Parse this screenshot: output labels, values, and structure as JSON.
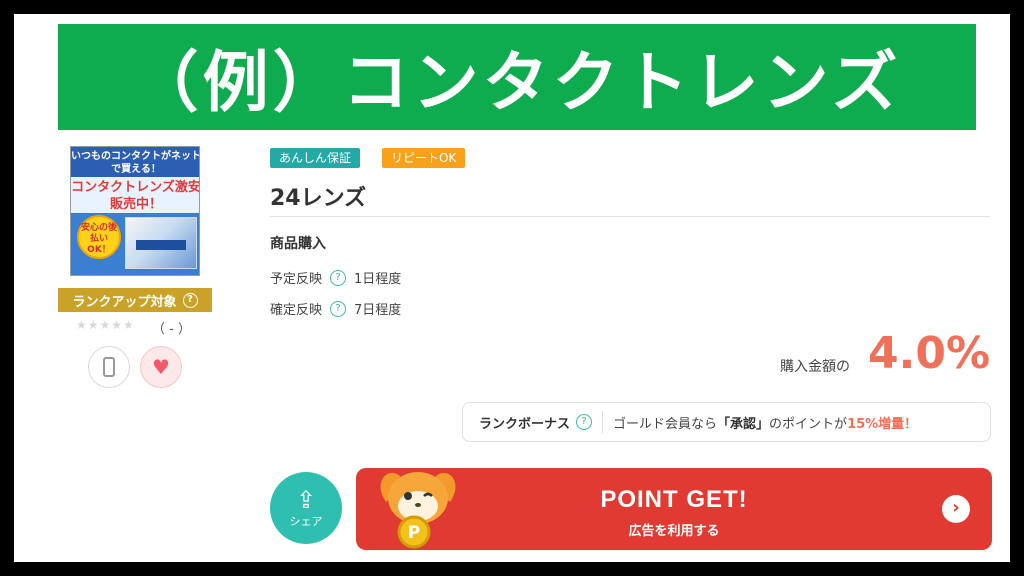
{
  "banner": {
    "title": "（例）コンタクトレンズ"
  },
  "thumbnail": {
    "line1": "いつものコンタクトがネットで買える！",
    "line2": "コンタクトレンズ激安販売中！",
    "seal": "安心の後払いOK！"
  },
  "rank_up": {
    "label": "ランクアップ対象"
  },
  "rating": {
    "stars": "★★★★★",
    "text": "（ - ）"
  },
  "tags": [
    "あんしん保証",
    "リピートOK"
  ],
  "product": {
    "title": "24レンズ",
    "section": "商品購入",
    "rows": [
      {
        "label": "予定反映",
        "value": "1日程度"
      },
      {
        "label": "確定反映",
        "value": "7日程度"
      }
    ]
  },
  "reward": {
    "label": "購入金額の",
    "value": "4.0%"
  },
  "bonus": {
    "label": "ランクボーナス",
    "text_pre": "ゴールド会員なら",
    "text_strong": "「承認」",
    "text_mid": "のポイントが",
    "text_em": "15%増量！"
  },
  "share": {
    "label": "シェア"
  },
  "cta": {
    "main": "POINT GET!",
    "sub": "広告を利用する"
  },
  "colors": {
    "banner": "#0fac4f",
    "cta": "#e03a32",
    "accent": "#f0705a",
    "teal": "#23a9a6"
  }
}
